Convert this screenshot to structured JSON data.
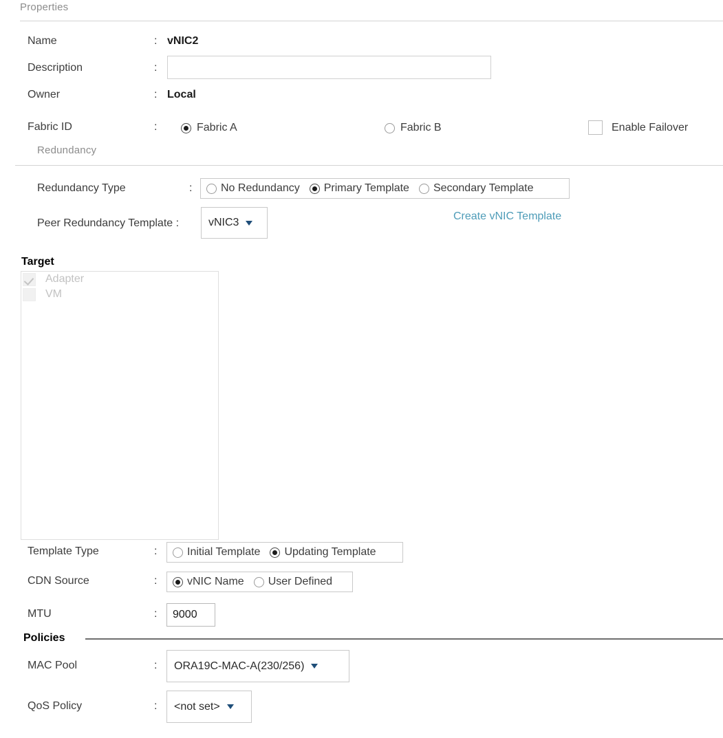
{
  "sections": {
    "properties_title": "Properties",
    "redundancy_title": "Redundancy",
    "target_title": "Target",
    "policies_title": "Policies"
  },
  "colon": ":",
  "fields": {
    "name": {
      "label": "Name",
      "value": "vNIC2"
    },
    "description": {
      "label": "Description",
      "value": "",
      "placeholder": ""
    },
    "owner": {
      "label": "Owner",
      "value": "Local"
    },
    "fabric_id": {
      "label": "Fabric ID",
      "options": [
        {
          "label": "Fabric A",
          "selected": true
        },
        {
          "label": "Fabric B",
          "selected": false
        }
      ],
      "enable_failover": {
        "label": "Enable Failover",
        "checked": false
      }
    },
    "redundancy_type": {
      "label": "Redundancy Type",
      "options": [
        {
          "label": "No Redundancy",
          "selected": false
        },
        {
          "label": "Primary Template",
          "selected": true
        },
        {
          "label": "Secondary Template",
          "selected": false
        }
      ]
    },
    "peer_redundancy_template": {
      "label": "Peer Redundancy Template :",
      "value": "vNIC3"
    },
    "create_vnic_template_link": "Create vNIC Template",
    "target_items": [
      {
        "label": "Adapter",
        "checked": true,
        "disabled": true
      },
      {
        "label": "VM",
        "checked": false,
        "disabled": true
      }
    ],
    "template_type": {
      "label": "Template Type",
      "options": [
        {
          "label": "Initial Template",
          "selected": false
        },
        {
          "label": "Updating Template",
          "selected": true
        }
      ]
    },
    "cdn_source": {
      "label": "CDN Source",
      "options": [
        {
          "label": "vNIC Name",
          "selected": true
        },
        {
          "label": "User Defined",
          "selected": false
        }
      ]
    },
    "mtu": {
      "label": "MTU",
      "value": "9000"
    },
    "mac_pool": {
      "label": "MAC Pool",
      "value": "ORA19C-MAC-A(230/256)"
    },
    "qos_policy": {
      "label": "QoS Policy",
      "value": "<not set>"
    }
  },
  "colors": {
    "link": "#4e9cb8",
    "dropdown_arrow": "#1f4e79",
    "section_header_grey": "#8c8c8c",
    "rule": "#d4d4d4"
  }
}
